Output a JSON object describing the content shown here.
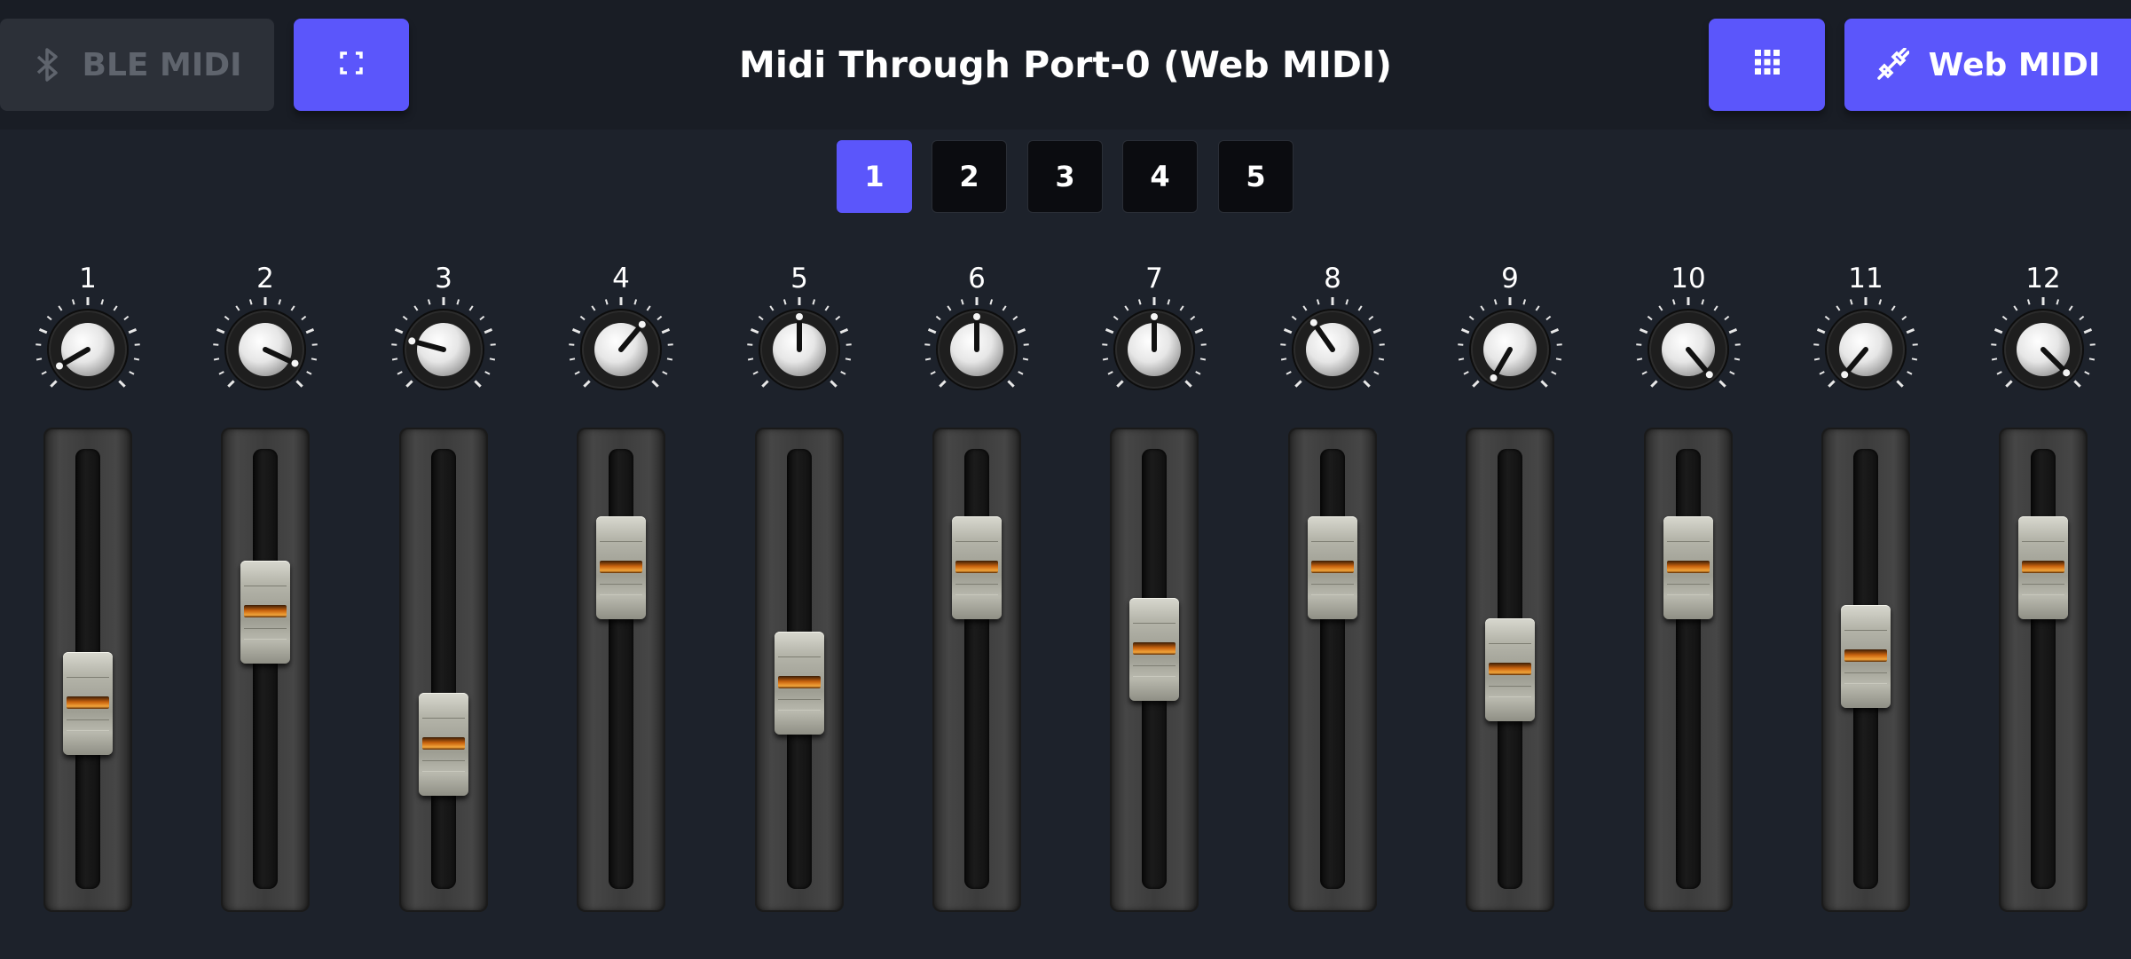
{
  "header": {
    "ble_button": {
      "label": "BLE MIDI",
      "icon": "bluetooth-icon",
      "state": "disabled"
    },
    "fullscreen_button": {
      "icon": "fullscreen-icon"
    },
    "title": "Midi Through Port-0 (Web MIDI)",
    "grid_button": {
      "icon": "grid-icon"
    },
    "webmidi_button": {
      "label": "Web MIDI",
      "icon": "midi-cable-icon"
    }
  },
  "pages": {
    "items": [
      {
        "label": "1"
      },
      {
        "label": "2"
      },
      {
        "label": "3"
      },
      {
        "label": "4"
      },
      {
        "label": "5"
      }
    ],
    "active_index": 0
  },
  "channels": [
    {
      "label": "1",
      "knob_angle": -120,
      "fader": 0.4
    },
    {
      "label": "2",
      "knob_angle": 115,
      "fader": 0.67
    },
    {
      "label": "3",
      "knob_angle": -75,
      "fader": 0.28
    },
    {
      "label": "4",
      "knob_angle": 40,
      "fader": 0.8
    },
    {
      "label": "5",
      "knob_angle": 0,
      "fader": 0.46
    },
    {
      "label": "6",
      "knob_angle": 0,
      "fader": 0.8
    },
    {
      "label": "7",
      "knob_angle": 0,
      "fader": 0.56
    },
    {
      "label": "8",
      "knob_angle": -35,
      "fader": 0.8
    },
    {
      "label": "9",
      "knob_angle": -150,
      "fader": 0.5
    },
    {
      "label": "10",
      "knob_angle": 140,
      "fader": 0.8
    },
    {
      "label": "11",
      "knob_angle": -140,
      "fader": 0.54
    },
    {
      "label": "12",
      "knob_angle": 135,
      "fader": 0.8
    }
  ],
  "colors": {
    "accent": "#5b56fb",
    "background": "#1d222b",
    "topbar": "#191d25"
  }
}
